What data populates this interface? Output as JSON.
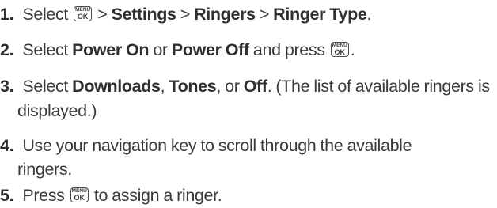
{
  "menu_key": {
    "top": "MENU",
    "bottom": "OK"
  },
  "steps": [
    {
      "number": "1.",
      "text_a": "Select",
      "sep": ">",
      "path": [
        "Settings",
        "Ringers",
        "Ringer Type"
      ],
      "end": "."
    },
    {
      "number": "2.",
      "text_a": "Select",
      "option_1": "Power On",
      "text_or": "or",
      "option_2": "Power Off",
      "text_b": "and press",
      "end": "."
    },
    {
      "number": "3.",
      "text_a": "Select",
      "option_1": "Downloads",
      "text_comma1": ",",
      "option_2": "Tones",
      "text_or": ", or",
      "option_3": "Off",
      "text_b": ". (The list of available ringers is",
      "line2": "displayed.)"
    },
    {
      "number": "4.",
      "line1": "Use your navigation key to scroll through the available",
      "line2": "ringers."
    },
    {
      "number": "5.",
      "text_a": "Press",
      "text_b": "to assign a ringer."
    }
  ]
}
